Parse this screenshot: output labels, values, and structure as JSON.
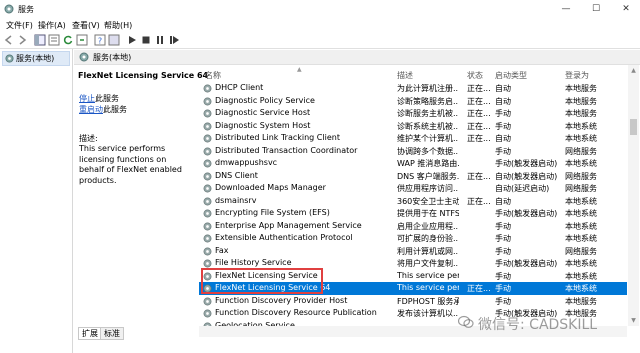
{
  "window": {
    "title": "服务",
    "minimize": "—",
    "maximize": "☐",
    "close": "✕"
  },
  "menu": [
    "文件(F)",
    "操作(A)",
    "查看(V)",
    "帮助(H)"
  ],
  "tree": {
    "root_label": "服务(本地)"
  },
  "header": {
    "label": "服务(本地)"
  },
  "detail": {
    "service_name": "FlexNet Licensing Service 64",
    "stop_link": "停止",
    "stop_suffix": "此服务",
    "restart_link": "重启动",
    "restart_suffix": "此服务",
    "desc_heading": "描述:",
    "desc_body": "This service performs licensing functions on behalf of FlexNet enabled products."
  },
  "columns": [
    "名称",
    "描述",
    "状态",
    "启动类型",
    "登录为"
  ],
  "rows": [
    [
      "DHCP Client",
      "为此计算机注册...",
      "正在...",
      "自动",
      "本地服务"
    ],
    [
      "Diagnostic Policy Service",
      "诊断策略服务启...",
      "正在...",
      "自动",
      "本地服务"
    ],
    [
      "Diagnostic Service Host",
      "诊断服务主机被...",
      "正在...",
      "手动",
      "本地服务"
    ],
    [
      "Diagnostic System Host",
      "诊断系统主机被...",
      "正在...",
      "手动",
      "本地系统"
    ],
    [
      "Distributed Link Tracking Client",
      "维护某个计算机...",
      "正在...",
      "自动",
      "本地系统"
    ],
    [
      "Distributed Transaction Coordinator",
      "协调跨多个数据...",
      "",
      "手动",
      "网络服务"
    ],
    [
      "dmwappushsvc",
      "WAP 推消息路由...",
      "",
      "手动(触发器启动)",
      "本地系统"
    ],
    [
      "DNS Client",
      "DNS 客户端服务...",
      "正在...",
      "自动(触发器启动)",
      "网络服务"
    ],
    [
      "Downloaded Maps Manager",
      "供应用程序访问...",
      "",
      "自动(延迟启动)",
      "网络服务"
    ],
    [
      "dsmainsrv",
      "360安全卫士主动...",
      "正在...",
      "自动",
      "本地系统"
    ],
    [
      "Encrypting File System (EFS)",
      "提供用于在 NTFS...",
      "",
      "手动(触发器启动)",
      "本地系统"
    ],
    [
      "Enterprise App Management Service",
      "启用企业应用程...",
      "",
      "手动",
      "本地系统"
    ],
    [
      "Extensible Authentication Protocol",
      "可扩展的身份验...",
      "",
      "手动",
      "本地系统"
    ],
    [
      "Fax",
      "利用计算机或网...",
      "",
      "手动",
      "网络服务"
    ],
    [
      "File History Service",
      "将用户文件复制...",
      "",
      "手动(触发器启动)",
      "本地系统"
    ],
    [
      "FlexNet Licensing Service",
      "This service perf...",
      "",
      "手动",
      "本地系统"
    ],
    [
      "FlexNet Licensing Service 64",
      "This service perf...",
      "正在...",
      "手动",
      "本地系统"
    ],
    [
      "Function Discovery Provider Host",
      "FDPHOST 服务承...",
      "",
      "手动",
      "本地服务"
    ],
    [
      "Function Discovery Resource Publication",
      "发布该计算机以...",
      "",
      "手动(触发器启动)",
      "本地服务"
    ],
    [
      "Geolocation Service",
      "",
      "",
      "",
      ""
    ]
  ],
  "selected_row": 16,
  "tabs": [
    "扩展",
    "标准"
  ],
  "watermark": "微信号: CADSKILL",
  "colors": {
    "selection": "#0078d7",
    "highlight_box": "#e04040"
  }
}
